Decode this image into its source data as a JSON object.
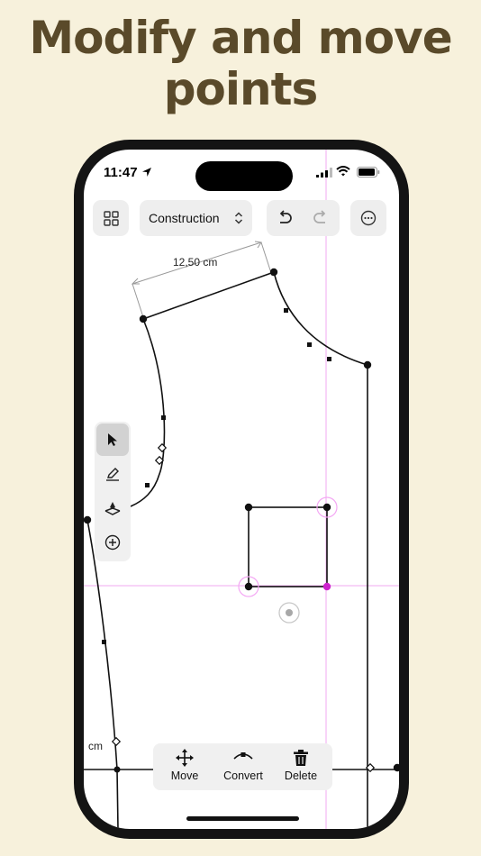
{
  "headline": {
    "line1": "Modify and move",
    "line2": "points"
  },
  "status_bar": {
    "time": "11:47"
  },
  "toolbar": {
    "pattern_selector_label": "Construction",
    "icons": [
      "grid-icon",
      "chevron-updown-icon",
      "undo-icon",
      "redo-icon",
      "more-icon"
    ]
  },
  "canvas": {
    "dimension_label": "12,50 cm",
    "side_label": "cm",
    "selection_color": "#cc22cc",
    "guide_color": "#f0a8f0"
  },
  "tools": [
    {
      "name": "select",
      "icon": "cursor-icon",
      "selected": true
    },
    {
      "name": "draw",
      "icon": "pen-icon",
      "selected": false
    },
    {
      "name": "point",
      "icon": "anchor-icon",
      "selected": false
    },
    {
      "name": "add",
      "icon": "plus-circle-icon",
      "selected": false
    }
  ],
  "actions": {
    "move": "Move",
    "convert": "Convert",
    "delete": "Delete"
  }
}
